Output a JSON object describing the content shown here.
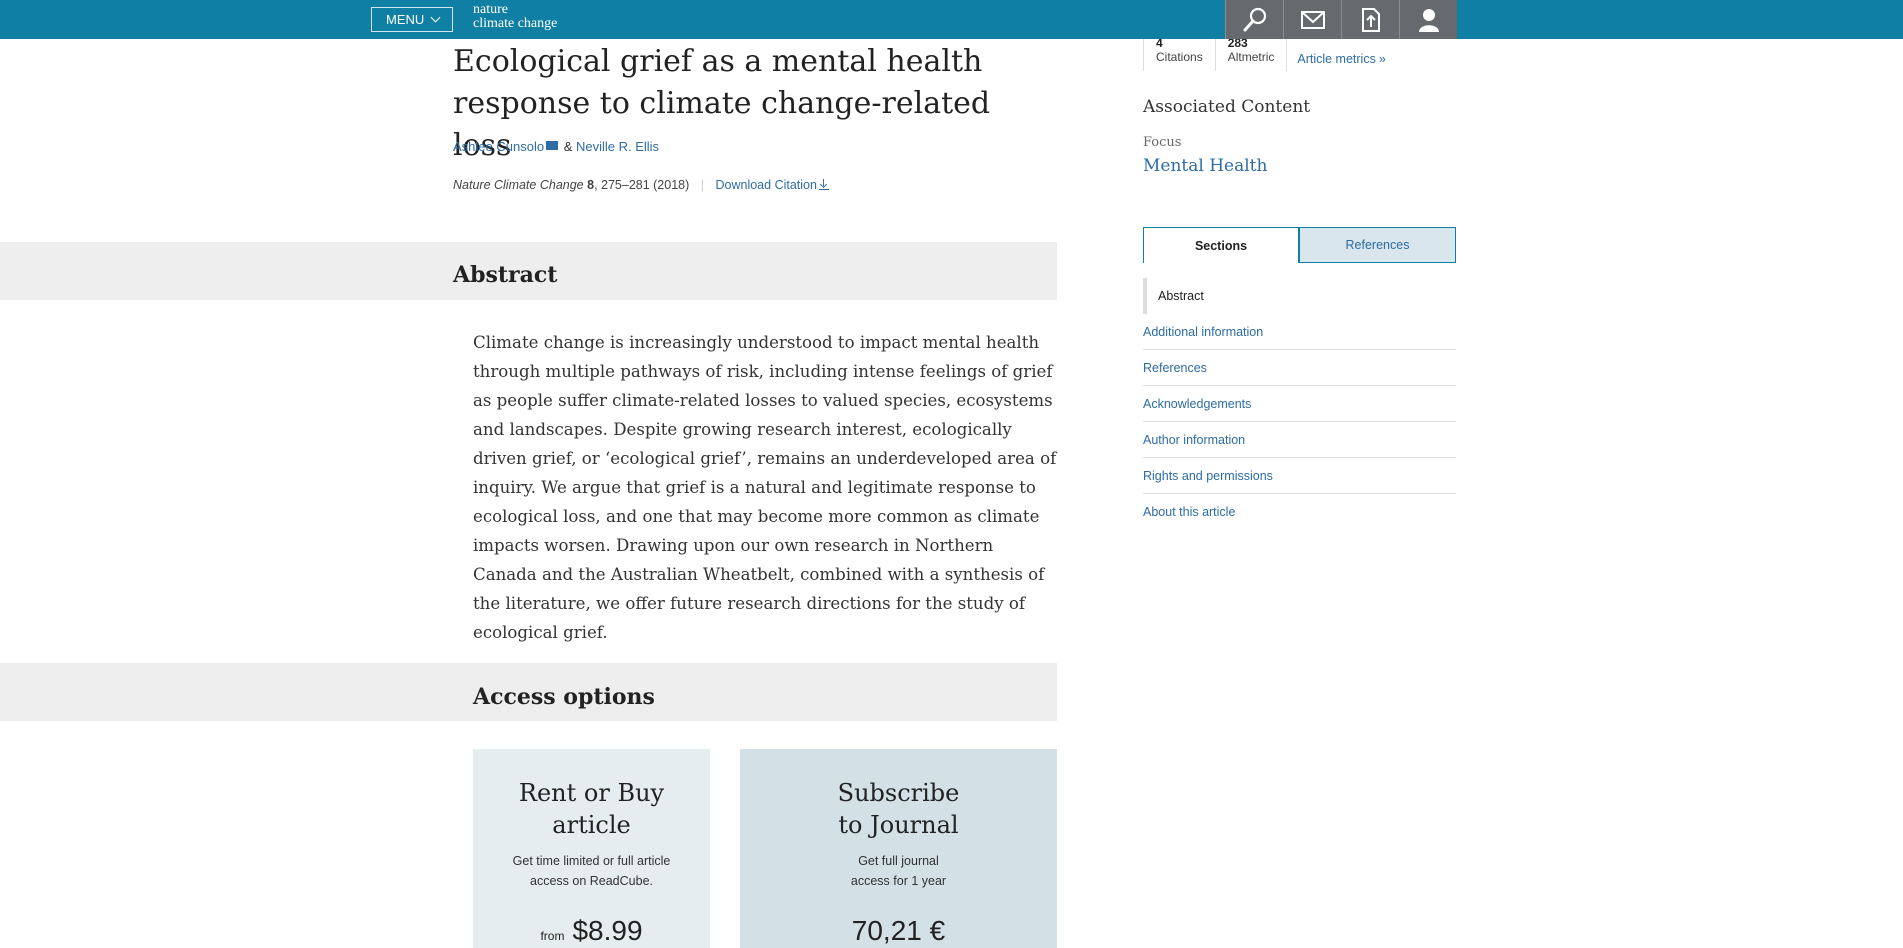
{
  "topbar": {
    "menu_label": "MENU",
    "logo_line1": "nature",
    "logo_line2": "climate change",
    "icons": [
      "search-icon",
      "mail-icon",
      "upload-icon",
      "user-icon"
    ]
  },
  "article": {
    "title": "Ecological grief as a mental health response to climate change-related loss",
    "author1": "Ashlee Cunsolo",
    "author_sep": "&",
    "author2": "Neville R. Ellis",
    "journal": "Nature Climate Change",
    "volume": "8",
    "pages_year": ", 275–281 (2018)",
    "separator": "|",
    "download_citation": "Download Citation"
  },
  "abstract": {
    "heading": "Abstract",
    "text": "Climate change is increasingly understood to impact mental health through multiple pathways of risk, including intense feelings of grief as people suffer climate-related losses to valued species, ecosystems and landscapes. Despite growing research interest, ecologically driven grief, or ‘ecological grief’, remains an underdeveloped area of inquiry. We argue that grief is a natural and legitimate response to ecological loss, and one that may become more common as climate impacts worsen. Drawing upon our own research in Northern Canada and the Australian Wheatbelt, combined with a synthesis of the literature, we offer future research directions for the study of ecological grief."
  },
  "access": {
    "heading": "Access options",
    "rent": {
      "title_line1": "Rent or Buy",
      "title_line2": "article",
      "desc_line1": "Get time limited or full article",
      "desc_line2": "access on ReadCube.",
      "from": "from",
      "price": "$8.99"
    },
    "subscribe": {
      "title_line1": "Subscribe",
      "title_line2": "to Journal",
      "desc_line1": "Get full journal",
      "desc_line2": "access for 1 year",
      "price": "70,21 €"
    }
  },
  "sidebar": {
    "citations_value": "4",
    "citations_label": "Citations",
    "altmetric_value": "283",
    "altmetric_label": "Altmetric",
    "metrics_link": "Article metrics",
    "associated_heading": "Associated Content",
    "focus_label": "Focus",
    "focus_link": "Mental Health",
    "tabs": [
      "Sections",
      "References"
    ],
    "sections": [
      "Abstract",
      "Additional information",
      "References",
      "Acknowledgements",
      "Author information",
      "Rights and permissions",
      "About this article"
    ]
  },
  "colors": {
    "brand": "#0f7fa4",
    "link": "#2e6ca3",
    "band": "#eeeeee"
  }
}
